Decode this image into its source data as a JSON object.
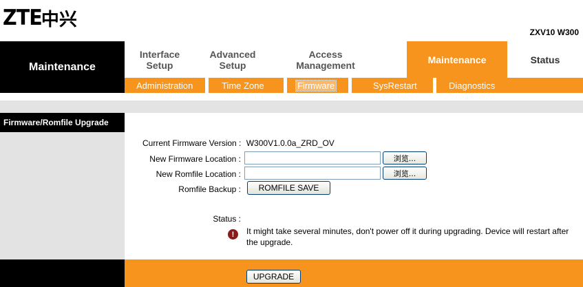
{
  "brand": {
    "logo_text": "ZTE",
    "logo_cn": "中兴",
    "model": "ZXV10 W300"
  },
  "header": {
    "section_title": "Maintenance"
  },
  "nav": {
    "tabs": [
      {
        "label_line1": "Interface",
        "label_line2": "Setup"
      },
      {
        "label_line1": "Advanced",
        "label_line2": "Setup"
      },
      {
        "label_line1": "Access",
        "label_line2": "Management"
      },
      {
        "label_line1": "Maintenance",
        "label_line2": ""
      },
      {
        "label_line1": "Status",
        "label_line2": ""
      }
    ],
    "active_tab": "Maintenance"
  },
  "subnav": {
    "items": [
      "Administration",
      "Time Zone",
      "Firmware",
      "SysRestart",
      "Diagnostics"
    ],
    "active_item": "Firmware"
  },
  "sidebar": {
    "section_label": "Firmware/Romfile Upgrade"
  },
  "form": {
    "current_version_label": "Current Firmware Version :",
    "current_version_value": "W300V1.0.0a_ZRD_OV",
    "new_firmware_label": "New Firmware Location :",
    "new_firmware_value": "",
    "new_romfile_label": "New Romfile Location :",
    "new_romfile_value": "",
    "browse_label": "浏览...",
    "romfile_backup_label": "Romfile Backup :",
    "romfile_save_button": "ROMFILE SAVE",
    "status_label": "Status :",
    "status_message_line1": "It might take several minutes, don't power off it during upgrading. Device will restart after",
    "status_message_line2": "the upgrade.",
    "warning_icon": "exclamation-circle-icon",
    "upgrade_button": "UPGRADE"
  },
  "colors": {
    "accent": "#f7941d",
    "dark": "#000000",
    "panel_gray": "#e3e3e3"
  }
}
